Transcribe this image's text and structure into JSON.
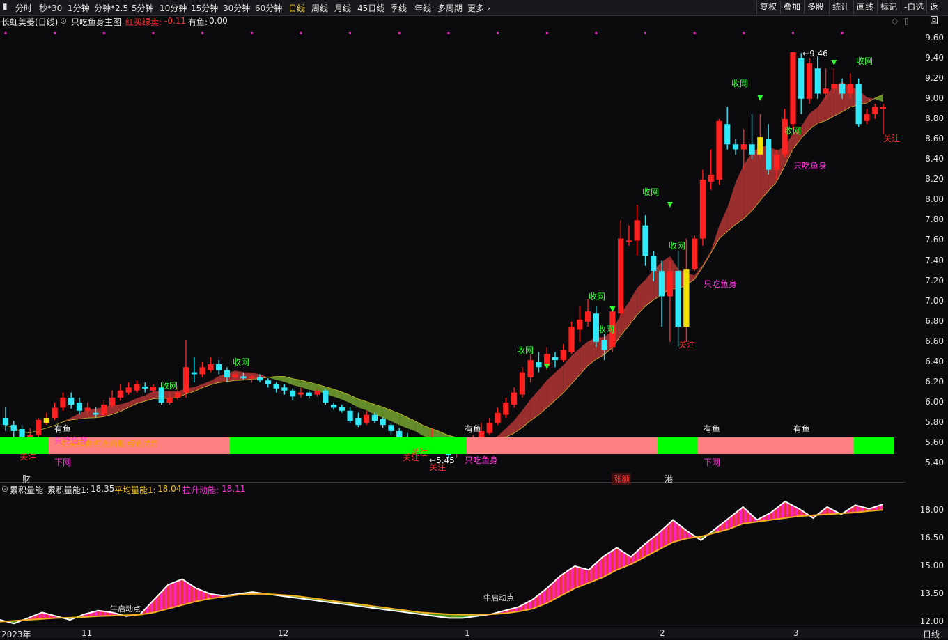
{
  "toolbar": {
    "periods": [
      "分时",
      "秒*30",
      "1分钟",
      "分钟*2.5",
      "5分钟",
      "10分钟",
      "15分钟",
      "30分钟",
      "60分钟",
      "日线",
      "周线",
      "月线",
      "45日线",
      "季线",
      "年线",
      "多周期",
      "更多 ›"
    ],
    "active_period": "日线",
    "right_buttons": [
      "复权",
      "叠加",
      "多股",
      "统计",
      "画线",
      "标记",
      "-自选",
      "返回"
    ]
  },
  "main_title": {
    "stock": "长虹美菱(日线)",
    "indicator": "只吃鱼身主图",
    "param1_label": "红买绿卖:",
    "param1_value": "-0.11",
    "param2_label": "有鱼:",
    "param2_value": "0.00"
  },
  "main_axis": {
    "ticks": [
      "9.60",
      "9.40",
      "9.20",
      "9.00",
      "8.80",
      "8.60",
      "8.40",
      "8.20",
      "8.00",
      "7.80",
      "7.60",
      "7.40",
      "7.20",
      "7.00",
      "6.80",
      "6.60",
      "6.40",
      "6.20",
      "6.00",
      "5.80",
      "5.60",
      "5.40"
    ],
    "high_label": "9.46",
    "low_label": "5.45"
  },
  "signals": {
    "shouwang": "收网",
    "guanzhu": "关注",
    "youyu": "有鱼",
    "zhichi": "只吃鱼身",
    "xiawang": "下网",
    "band_note": "红买绿卖:红色持股,绿色持币",
    "cai": "财",
    "zhangdie": "涨额",
    "gang": "港"
  },
  "sub_title": {
    "name": "累积量能",
    "l1_label": "累积量能1:",
    "l1_value": "18.35",
    "l2_label": "平均量能1:",
    "l2_value": "18.04",
    "l3_label": "拉升动能:",
    "l3_value": "18.11",
    "start_label": "牛启动点"
  },
  "sub_axis": {
    "ticks": [
      "18.00",
      "16.50",
      "15.00",
      "13.50",
      "12.00"
    ]
  },
  "xaxis": {
    "labels": [
      "2023年",
      "11",
      "12",
      "1",
      "2",
      "3"
    ],
    "period": "日线"
  },
  "colors": {
    "up": "#ff2020",
    "down": "#30e8f8",
    "band_red": "#a83232",
    "band_green": "#6f9a2e",
    "green_bar": "#00ff00",
    "pink_bar": "#ff8080",
    "magenta": "#ff22cc",
    "yellow": "#f0c020"
  },
  "chart_data": {
    "type": "candlestick",
    "unit": "price",
    "ylim": [
      5.3,
      9.7
    ],
    "sub_ylim": [
      11.8,
      18.8
    ],
    "candles": [
      [
        5.85,
        5.78,
        5.96,
        5.72
      ],
      [
        5.78,
        5.72,
        5.82,
        5.66
      ],
      [
        5.74,
        5.63,
        5.78,
        5.58
      ],
      [
        5.63,
        5.68,
        5.75,
        5.6
      ],
      [
        5.68,
        5.83,
        5.85,
        5.65
      ],
      [
        5.8,
        5.85,
        5.9,
        5.78
      ],
      [
        5.85,
        5.95,
        6.0,
        5.83
      ],
      [
        5.95,
        6.05,
        6.1,
        5.92
      ],
      [
        6.05,
        5.98,
        6.1,
        5.94
      ],
      [
        6.0,
        5.92,
        6.05,
        5.88
      ],
      [
        5.92,
        5.95,
        6.0,
        5.88
      ],
      [
        5.9,
        5.88,
        5.96,
        5.85
      ],
      [
        5.88,
        5.98,
        6.02,
        5.86
      ],
      [
        5.97,
        6.05,
        6.12,
        5.95
      ],
      [
        6.05,
        6.12,
        6.18,
        6.02
      ],
      [
        6.1,
        6.15,
        6.2,
        6.08
      ],
      [
        6.12,
        6.18,
        6.22,
        6.1
      ],
      [
        6.16,
        6.14,
        6.2,
        6.1
      ],
      [
        6.12,
        6.16,
        6.18,
        6.1
      ],
      [
        6.15,
        6.0,
        6.2,
        5.98
      ],
      [
        6.0,
        6.05,
        6.1,
        5.98
      ],
      [
        6.05,
        6.1,
        6.15,
        6.02
      ],
      [
        6.1,
        6.35,
        6.62,
        6.05
      ],
      [
        6.3,
        6.28,
        6.45,
        6.2
      ],
      [
        6.28,
        6.35,
        6.4,
        6.25
      ],
      [
        6.32,
        6.38,
        6.45,
        6.3
      ],
      [
        6.38,
        6.32,
        6.42,
        6.28
      ],
      [
        6.32,
        6.25,
        6.35,
        6.2
      ],
      [
        6.25,
        6.28,
        6.3,
        6.22
      ],
      [
        6.26,
        6.24,
        6.3,
        6.22
      ],
      [
        6.24,
        6.26,
        6.28,
        6.2
      ],
      [
        6.25,
        6.22,
        6.28,
        6.2
      ],
      [
        6.22,
        6.18,
        6.24,
        6.15
      ],
      [
        6.18,
        6.14,
        6.2,
        6.1
      ],
      [
        6.15,
        6.12,
        6.18,
        6.08
      ],
      [
        6.12,
        6.06,
        6.14,
        6.02
      ],
      [
        6.08,
        6.1,
        6.15,
        6.05
      ],
      [
        6.1,
        6.07,
        6.12,
        6.04
      ],
      [
        6.08,
        6.12,
        6.14,
        6.06
      ],
      [
        6.12,
        6.0,
        6.14,
        5.98
      ],
      [
        5.98,
        5.95,
        6.0,
        5.93
      ],
      [
        5.96,
        5.92,
        5.98,
        5.9
      ],
      [
        5.92,
        5.82,
        5.95,
        5.8
      ],
      [
        5.85,
        5.78,
        5.9,
        5.76
      ],
      [
        5.8,
        5.88,
        5.92,
        5.78
      ],
      [
        5.88,
        5.82,
        5.9,
        5.8
      ],
      [
        5.84,
        5.78,
        5.86,
        5.75
      ],
      [
        5.78,
        5.72,
        5.8,
        5.68
      ],
      [
        5.72,
        5.65,
        5.75,
        5.62
      ],
      [
        5.66,
        5.6,
        5.7,
        5.58
      ],
      [
        5.62,
        5.56,
        5.65,
        5.52
      ],
      [
        5.58,
        5.55,
        5.62,
        5.5
      ],
      [
        5.57,
        5.62,
        5.75,
        5.55
      ],
      [
        5.62,
        5.55,
        5.65,
        5.5
      ],
      [
        5.55,
        5.48,
        5.58,
        5.45
      ],
      [
        5.5,
        5.55,
        5.58,
        5.46
      ],
      [
        5.55,
        5.6,
        5.62,
        5.52
      ],
      [
        5.58,
        5.65,
        5.68,
        5.56
      ],
      [
        5.65,
        5.72,
        5.8,
        5.62
      ],
      [
        5.7,
        5.8,
        5.85,
        5.68
      ],
      [
        5.8,
        5.9,
        5.95,
        5.78
      ],
      [
        5.88,
        6.0,
        6.05,
        5.85
      ],
      [
        5.98,
        6.1,
        6.15,
        5.95
      ],
      [
        6.08,
        6.3,
        6.35,
        6.05
      ],
      [
        6.25,
        6.42,
        6.48,
        6.2
      ],
      [
        6.4,
        6.35,
        6.5,
        6.3
      ],
      [
        6.36,
        6.48,
        6.55,
        6.32
      ],
      [
        6.45,
        6.42,
        6.5,
        6.35
      ],
      [
        6.42,
        6.52,
        6.58,
        6.4
      ],
      [
        6.5,
        6.75,
        6.8,
        6.48
      ],
      [
        6.72,
        6.82,
        6.95,
        6.6
      ],
      [
        6.8,
        6.9,
        7.02,
        6.75
      ],
      [
        6.88,
        6.6,
        6.95,
        6.55
      ],
      [
        6.62,
        6.52,
        6.68,
        6.42
      ],
      [
        6.55,
        6.9,
        6.95,
        6.5
      ],
      [
        6.88,
        7.62,
        7.8,
        6.85
      ],
      [
        7.6,
        7.6,
        7.75,
        7.55
      ],
      [
        7.6,
        7.8,
        7.95,
        7.45
      ],
      [
        7.75,
        7.45,
        7.85,
        7.35
      ],
      [
        7.45,
        7.3,
        7.5,
        7.2
      ],
      [
        7.3,
        7.05,
        7.4,
        6.75
      ],
      [
        7.05,
        7.3,
        7.4,
        6.6
      ],
      [
        7.3,
        6.75,
        7.5,
        6.55
      ],
      [
        6.75,
        7.32,
        7.62,
        6.6
      ],
      [
        7.32,
        7.62,
        7.65,
        7.3
      ],
      [
        7.62,
        8.2,
        8.3,
        7.55
      ],
      [
        8.18,
        8.25,
        8.5,
        8.1
      ],
      [
        8.2,
        8.78,
        8.8,
        8.15
      ],
      [
        8.75,
        8.55,
        8.92,
        8.5
      ],
      [
        8.55,
        8.5,
        8.6,
        8.45
      ],
      [
        8.5,
        8.55,
        8.7,
        8.3
      ],
      [
        8.55,
        8.45,
        8.85,
        8.4
      ],
      [
        8.45,
        8.62,
        8.85,
        8.4
      ],
      [
        8.6,
        8.3,
        8.75,
        8.25
      ],
      [
        8.3,
        8.45,
        8.5,
        8.2
      ],
      [
        8.45,
        8.8,
        8.9,
        8.42
      ],
      [
        8.75,
        9.46,
        9.46,
        8.7
      ],
      [
        9.4,
        9.0,
        9.45,
        8.85
      ],
      [
        9.0,
        9.35,
        9.4,
        8.95
      ],
      [
        9.3,
        9.05,
        9.42,
        9.0
      ],
      [
        9.05,
        9.1,
        9.3,
        9.0
      ],
      [
        9.1,
        9.15,
        9.3,
        9.05
      ],
      [
        9.15,
        9.05,
        9.2,
        9.0
      ],
      [
        9.05,
        9.15,
        9.25,
        9.0
      ],
      [
        9.15,
        8.75,
        9.2,
        8.72
      ],
      [
        8.78,
        8.85,
        8.9,
        8.75
      ],
      [
        8.85,
        8.92,
        8.95,
        8.8
      ],
      [
        8.9,
        8.92,
        8.95,
        8.65
      ]
    ],
    "cum_energy": [
      12.1,
      11.9,
      12.2,
      12.5,
      12.3,
      12.1,
      12.4,
      12.6,
      12.5,
      12.3,
      12.4,
      13.2,
      14.0,
      14.3,
      13.8,
      13.5,
      13.4,
      13.5,
      13.6,
      13.5,
      13.4,
      13.3,
      13.2,
      13.1,
      13.0,
      12.9,
      12.8,
      12.7,
      12.6,
      12.5,
      12.4,
      12.3,
      12.2,
      12.2,
      12.3,
      12.4,
      12.6,
      12.8,
      13.2,
      13.8,
      14.5,
      15.0,
      14.8,
      15.5,
      16.0,
      15.5,
      16.2,
      16.8,
      17.5,
      16.9,
      16.4,
      17.0,
      17.6,
      18.2,
      17.5,
      17.9,
      18.5,
      18.1,
      17.6,
      18.2,
      17.8,
      18.3,
      18.1,
      18.35
    ],
    "avg_energy": [
      12.0,
      12.05,
      12.1,
      12.15,
      12.2,
      12.22,
      12.25,
      12.3,
      12.32,
      12.35,
      12.38,
      12.5,
      12.7,
      12.9,
      13.1,
      13.25,
      13.35,
      13.45,
      13.5,
      13.5,
      13.45,
      13.4,
      13.3,
      13.2,
      13.1,
      13.0,
      12.9,
      12.8,
      12.7,
      12.6,
      12.5,
      12.45,
      12.4,
      12.38,
      12.38,
      12.4,
      12.45,
      12.55,
      12.7,
      13.0,
      13.4,
      13.8,
      14.1,
      14.4,
      14.8,
      15.1,
      15.5,
      15.9,
      16.3,
      16.5,
      16.6,
      16.8,
      17.0,
      17.3,
      17.4,
      17.5,
      17.6,
      17.7,
      17.75,
      17.8,
      17.85,
      17.9,
      17.98,
      18.04
    ]
  }
}
